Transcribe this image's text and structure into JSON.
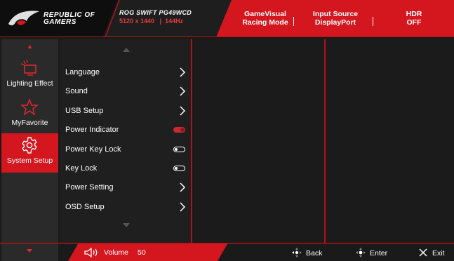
{
  "colors": {
    "accent": "#d4161f",
    "dark_bg": "#1a1a1a",
    "sidebar_bg": "#2a2a2a"
  },
  "header": {
    "brand": "REPUBLIC OF GAMERS",
    "brand_line1": "REPUBLIC OF",
    "brand_line2": "GAMERS",
    "model": "ROG SWIFT PG49WCD",
    "resolution": "5120 x 1440",
    "refresh": "144Hz",
    "status": [
      {
        "line1": "GameVisual",
        "line2": "Racing Mode"
      },
      {
        "line1": "Input Source",
        "line2": "DisplayPort"
      },
      {
        "line1": "HDR",
        "line2": "OFF"
      }
    ]
  },
  "sidebar": {
    "items": [
      {
        "label": "Lighting Effect",
        "icon": "lighting-effect-icon",
        "active": false
      },
      {
        "label": "MyFavorite",
        "icon": "star-icon",
        "active": false
      },
      {
        "label": "System Setup",
        "icon": "gear-icon",
        "active": true
      }
    ]
  },
  "menu": {
    "items": [
      {
        "label": "Language",
        "control": "submenu"
      },
      {
        "label": "Sound",
        "control": "submenu"
      },
      {
        "label": "USB Setup",
        "control": "submenu"
      },
      {
        "label": "Power Indicator",
        "control": "toggle-on"
      },
      {
        "label": "Power Key Lock",
        "control": "toggle-off"
      },
      {
        "label": "Key Lock",
        "control": "toggle-off"
      },
      {
        "label": "Power Setting",
        "control": "submenu"
      },
      {
        "label": "OSD Setup",
        "control": "submenu"
      }
    ]
  },
  "footer": {
    "volume_label": "Volume",
    "volume_value": "50",
    "back_label": "Back",
    "enter_label": "Enter",
    "exit_label": "Exit"
  }
}
